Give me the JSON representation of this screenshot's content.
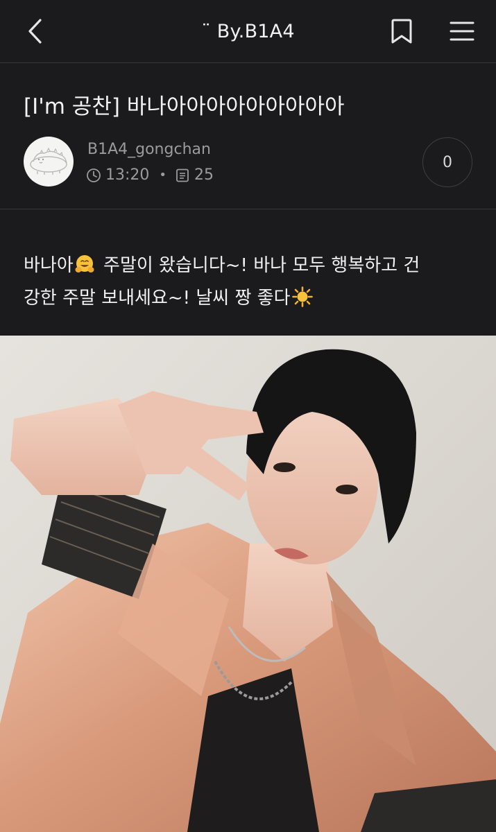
{
  "header": {
    "title": "¨ By.B1A4",
    "back_icon": "chevron-left-icon",
    "bookmark_icon": "bookmark-icon",
    "menu_icon": "hamburger-menu-icon"
  },
  "post": {
    "title": "[I'm 공찬] 바나아아아아아아아아아",
    "author": "B1A4_gongchan",
    "time": "13:20",
    "views": "25",
    "comment_count": "0",
    "body_line1_a": "바나아",
    "body_line1_b": " 주말이 왔습니다~! 바나 모두 행복하고 건",
    "body_line2": "강한 주말 보내세요~! 날씨 짱 좋다",
    "emoji_1": "hugging-face-emoji",
    "emoji_2": "sun-emoji"
  },
  "colors": {
    "background": "#1b1b1d",
    "text": "#f1f1f1",
    "muted": "#9b9b9f",
    "divider": "#37373a"
  }
}
